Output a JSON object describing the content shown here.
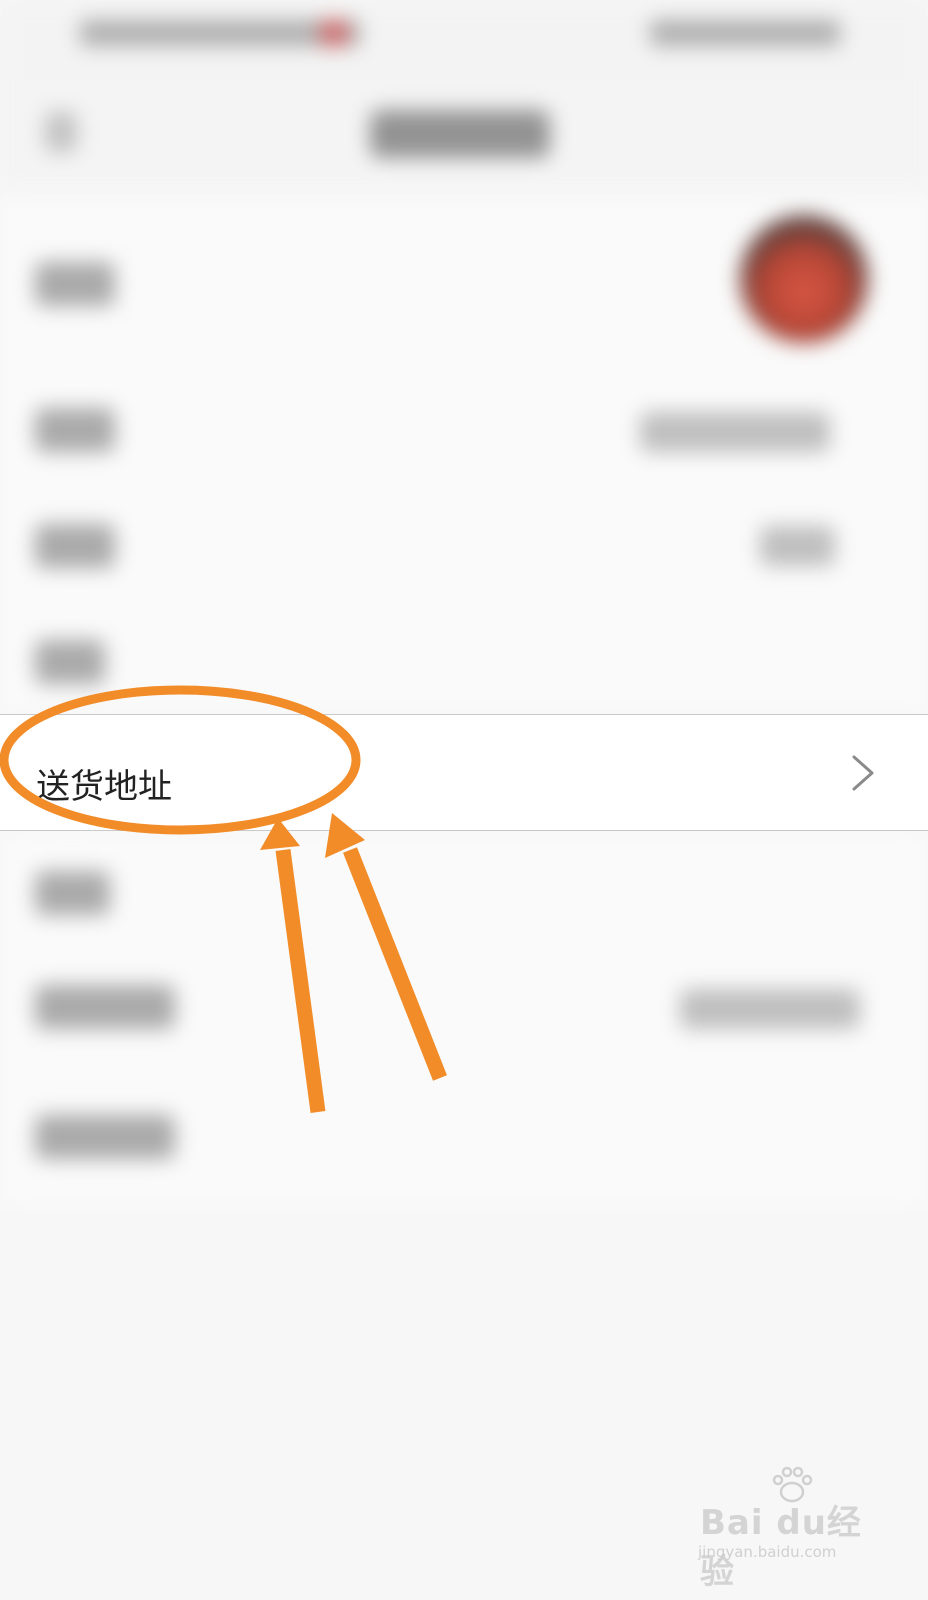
{
  "settings": {
    "address_row": {
      "label": "送货地址"
    }
  },
  "icons": {
    "chevron": "chevron-right-icon",
    "back": "back-arrow-icon"
  },
  "colors": {
    "annotation": "#f28c28",
    "divider": "#c9c9c9",
    "label_text": "#222222"
  },
  "watermark": {
    "brand": "Bai du经验",
    "url": "jingyan.baidu.com"
  }
}
